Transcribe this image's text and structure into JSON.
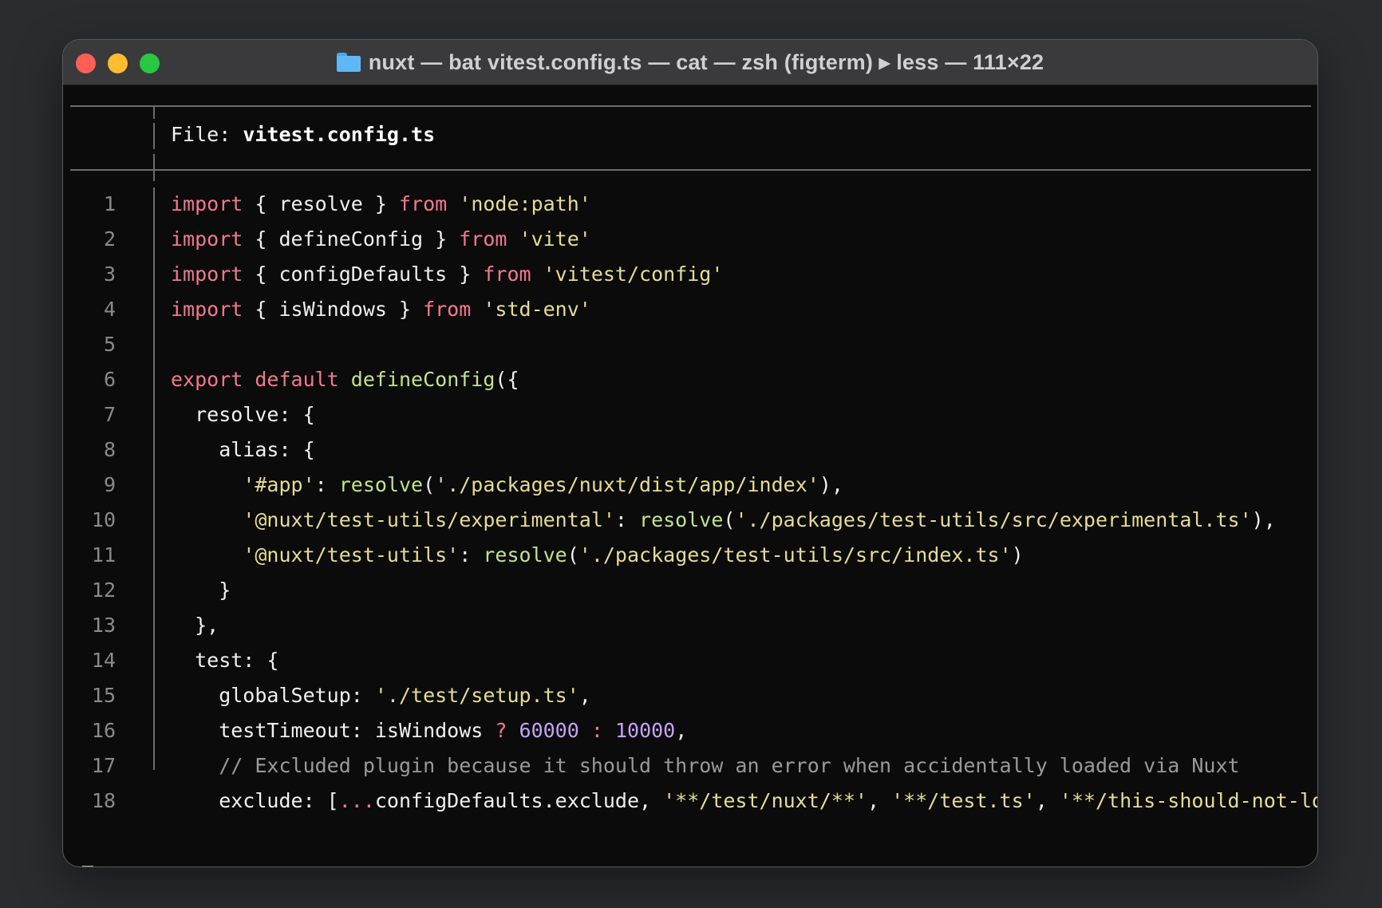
{
  "window": {
    "title": "nuxt — bat vitest.config.ts — cat — zsh (figterm) ▸ less — 111×22"
  },
  "header": {
    "file_label": "File: ",
    "file_name": "vitest.config.ts"
  },
  "lines": [
    {
      "n": "1",
      "tokens": [
        [
          "kw",
          "import"
        ],
        [
          "",
          "{ resolve } "
        ],
        [
          "kw",
          "from"
        ],
        [
          "",
          " "
        ],
        [
          "str",
          "'node:path'"
        ]
      ]
    },
    {
      "n": "2",
      "tokens": [
        [
          "kw",
          "import"
        ],
        [
          "",
          "{ defineConfig } "
        ],
        [
          "kw",
          "from"
        ],
        [
          "",
          " "
        ],
        [
          "str",
          "'vite'"
        ]
      ]
    },
    {
      "n": "3",
      "tokens": [
        [
          "kw",
          "import"
        ],
        [
          "",
          "{ configDefaults } "
        ],
        [
          "kw",
          "from"
        ],
        [
          "",
          " "
        ],
        [
          "str",
          "'vitest/config'"
        ]
      ]
    },
    {
      "n": "4",
      "tokens": [
        [
          "kw",
          "import"
        ],
        [
          "",
          "{ isWindows } "
        ],
        [
          "kw",
          "from"
        ],
        [
          "",
          " "
        ],
        [
          "str",
          "'std-env'"
        ]
      ]
    },
    {
      "n": "5",
      "tokens": []
    },
    {
      "n": "6",
      "tokens": [
        [
          "kw",
          "export"
        ],
        [
          "",
          " "
        ],
        [
          "kw",
          "default"
        ],
        [
          "",
          " "
        ],
        [
          "fn",
          "defineConfig"
        ],
        [
          "",
          "({"
        ]
      ]
    },
    {
      "n": "7",
      "tokens": [
        [
          "",
          "  resolve: {"
        ]
      ]
    },
    {
      "n": "8",
      "tokens": [
        [
          "",
          "    alias: {"
        ]
      ]
    },
    {
      "n": "9",
      "tokens": [
        [
          "",
          "      "
        ],
        [
          "str",
          "'#app'"
        ],
        [
          "",
          ": "
        ],
        [
          "fn",
          "resolve"
        ],
        [
          "",
          "("
        ],
        [
          "str",
          "'./packages/nuxt/dist/app/index'"
        ],
        [
          "",
          "),"
        ]
      ]
    },
    {
      "n": "10",
      "tokens": [
        [
          "",
          "      "
        ],
        [
          "str",
          "'@nuxt/test-utils/experimental'"
        ],
        [
          "",
          ": "
        ],
        [
          "fn",
          "resolve"
        ],
        [
          "",
          "("
        ],
        [
          "str",
          "'./packages/test-utils/src/experimental.ts'"
        ],
        [
          "",
          "),"
        ]
      ]
    },
    {
      "n": "11",
      "tokens": [
        [
          "",
          "      "
        ],
        [
          "str",
          "'@nuxt/test-utils'"
        ],
        [
          "",
          ": "
        ],
        [
          "fn",
          "resolve"
        ],
        [
          "",
          "("
        ],
        [
          "str",
          "'./packages/test-utils/src/index.ts'"
        ],
        [
          "",
          ")"
        ]
      ]
    },
    {
      "n": "12",
      "tokens": [
        [
          "",
          "    }"
        ]
      ]
    },
    {
      "n": "13",
      "tokens": [
        [
          "",
          "  },"
        ]
      ]
    },
    {
      "n": "14",
      "tokens": [
        [
          "",
          "  test: {"
        ]
      ]
    },
    {
      "n": "15",
      "tokens": [
        [
          "",
          "    globalSetup: "
        ],
        [
          "str",
          "'./test/setup.ts'"
        ],
        [
          "",
          ","
        ]
      ]
    },
    {
      "n": "16",
      "tokens": [
        [
          "",
          "    testTimeout: isWindows "
        ],
        [
          "op",
          "?"
        ],
        [
          "",
          " "
        ],
        [
          "num",
          "60000"
        ],
        [
          "",
          " "
        ],
        [
          "op",
          ":"
        ],
        [
          "",
          " "
        ],
        [
          "num",
          "10000"
        ],
        [
          "",
          ","
        ]
      ]
    },
    {
      "n": "17",
      "tokens": [
        [
          "cm",
          "    // Excluded plugin because it should throw an error when accidentally loaded via Nuxt"
        ]
      ]
    },
    {
      "n": "18",
      "tokens": [
        [
          "",
          "    exclude: ["
        ],
        [
          "op",
          "..."
        ],
        [
          "",
          "configDefaults.exclude, "
        ],
        [
          "str",
          "'**/test/nuxt/**'"
        ],
        [
          "",
          ", "
        ],
        [
          "str",
          "'**/test.ts'"
        ],
        [
          "",
          ", "
        ],
        [
          "str",
          "'**/this-should-not-load.spe"
        ]
      ]
    }
  ],
  "prompt": ":"
}
